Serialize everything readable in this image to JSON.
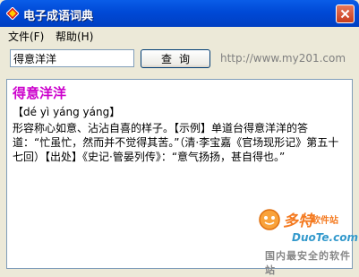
{
  "window": {
    "title": "电子成语词典",
    "icon": "diamond-app-icon",
    "close_icon": "close-icon"
  },
  "menu": {
    "items": [
      {
        "label": "文件(F)"
      },
      {
        "label": "帮助(H)"
      }
    ]
  },
  "search": {
    "value": "得意洋洋",
    "button_label": "查询",
    "url": "http://www.my201.com"
  },
  "entry": {
    "headword": "得意洋洋",
    "pinyin": "【dé yì yáng yáng】",
    "definition": "形容称心如意、沾沾自喜的样子。【示例】单道台得意洋洋的答道：“忙虽忙，然而并不觉得其苦。”（清·李宝嘉《官场现形记》第五十七回）【出处】《史记·管晏列传》：“意气扬扬，甚自得也。”"
  },
  "watermark": {
    "brand": "多特",
    "brand_sub": "软件站",
    "url": "DuoTe.com",
    "slogan": "国内最安全的软件站"
  },
  "colors": {
    "titlebar": "#0054e3",
    "headword": "#cc00cc",
    "watermark_orange": "#f47a20",
    "watermark_blue": "#3399cc"
  }
}
